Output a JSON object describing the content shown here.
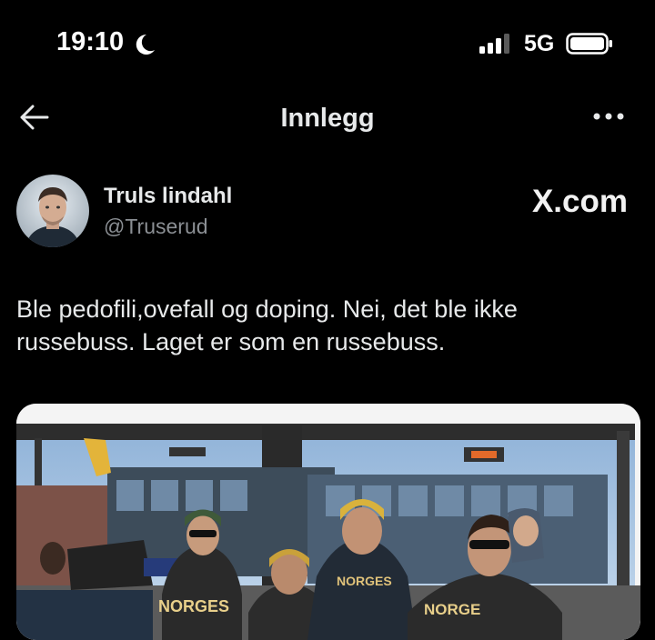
{
  "status_bar": {
    "time": "19:10",
    "network": "5G"
  },
  "nav": {
    "title": "Innlegg"
  },
  "post": {
    "author_name": "Truls lindahl",
    "author_handle": "@Truserud",
    "watermark": "X.com",
    "text_line1": "Ble pedofili,ovefall og doping. Nei, det ble ikke",
    "text_line2": "russebuss. Laget er som en russebuss."
  },
  "media": {
    "jersey_text_1": "NORGES",
    "jersey_text_2": "NORGES",
    "jersey_text_3": "NORGE"
  },
  "icons": [
    "moon-icon",
    "signal-icon",
    "battery-icon",
    "back-arrow-icon",
    "more-icon"
  ]
}
